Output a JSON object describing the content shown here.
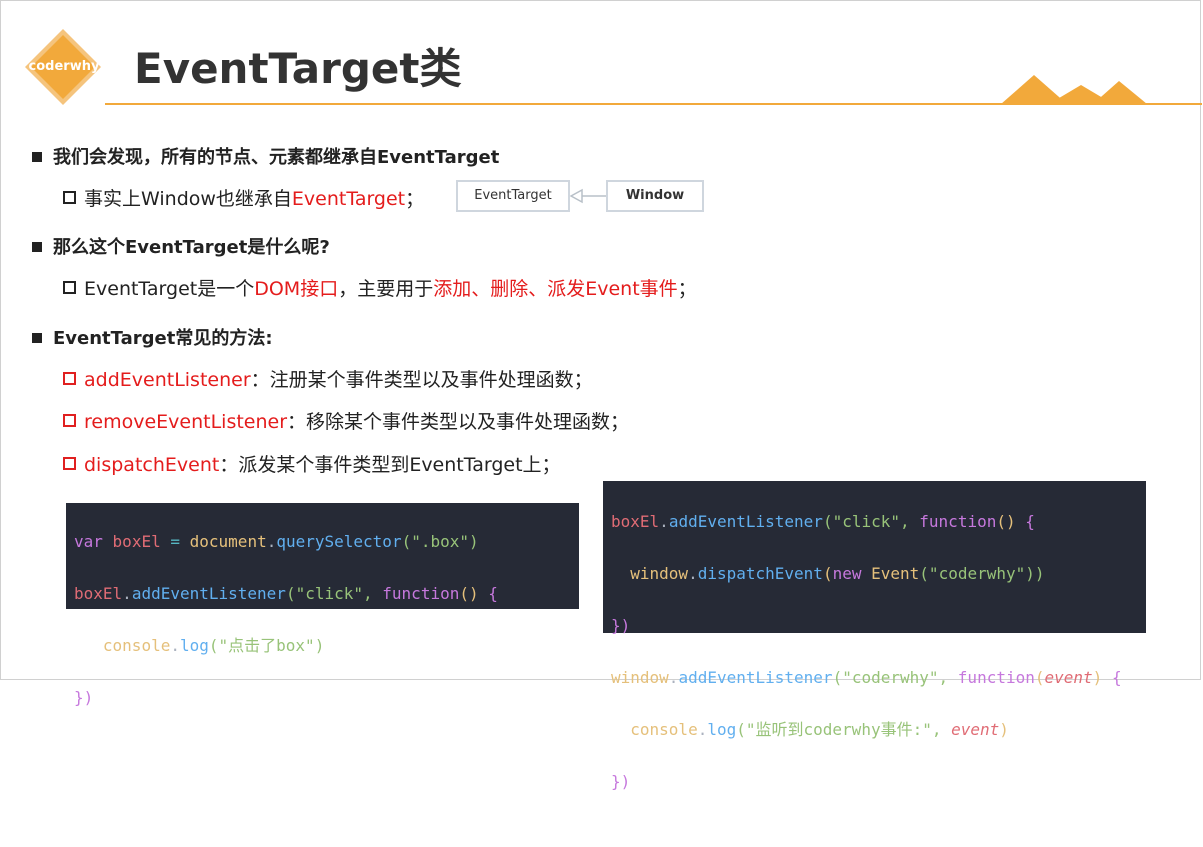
{
  "header": {
    "logo_text": "coderwhy",
    "title": "EventTarget类"
  },
  "bullets": [
    {
      "text": "我们会发现，所有的节点、元素都继承自EventTarget"
    },
    {
      "text": "那么这个EventTarget是什么呢?"
    },
    {
      "text": "EventTarget常见的方法:"
    }
  ],
  "sub1": {
    "prefix": "事实上Window也继承自",
    "highlight": "EventTarget",
    "suffix": "；"
  },
  "diagram": {
    "left_box": "EventTarget",
    "right_box": "Window"
  },
  "sub2": {
    "prefix": "EventTarget是一个",
    "h1": "DOM接口",
    "mid": "，主要用于",
    "h2": "添加、删除、派发Event事件",
    "suffix": "；"
  },
  "methods": [
    {
      "name": "addEventListener",
      "desc": "：注册某个事件类型以及事件处理函数；"
    },
    {
      "name": "removeEventListener",
      "desc": "：移除某个事件类型以及事件处理函数；"
    },
    {
      "name": "dispatchEvent",
      "desc": "：派发某个事件类型到EventTarget上；"
    }
  ],
  "code1": {
    "l1": [
      "var",
      "boxEl",
      "=",
      "document",
      ".",
      "querySelector",
      "(\".box\")"
    ],
    "l2": [
      "boxEl",
      ".",
      "addEventListener",
      "(\"click\",",
      "function",
      "()",
      "{"
    ],
    "l3": [
      "console",
      ".",
      "log",
      "(\"点击了box\")"
    ],
    "l4": [
      "})"
    ]
  },
  "code2": {
    "l1": [
      "boxEl",
      ".",
      "addEventListener",
      "(\"click\",",
      "function",
      "()",
      "{"
    ],
    "l2": [
      "window",
      ".",
      "dispatchEvent",
      "(",
      "new",
      "Event",
      "(\"coderwhy\"))"
    ],
    "l3": [
      "})"
    ],
    "l4": [
      "window",
      ".",
      "addEventListener",
      "(\"coderwhy\",",
      "function",
      "(",
      "event",
      ")",
      "{"
    ],
    "l5": [
      "console",
      ".",
      "log",
      "(\"监听到coderwhy事件:\",",
      "event",
      ")"
    ],
    "l6": [
      "})"
    ]
  },
  "colors": {
    "accent": "#f2a93b",
    "highlight": "#e41c1c",
    "code_bg": "#262a36"
  }
}
